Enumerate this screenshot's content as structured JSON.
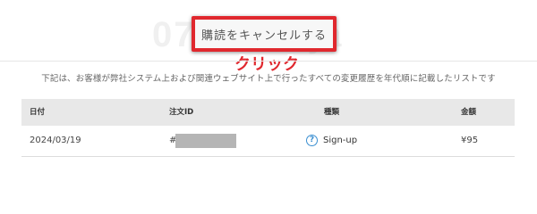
{
  "watermark": "0723.ninja",
  "cancel_button": {
    "label": "購読をキャンセルする"
  },
  "annotation": {
    "click_label": "クリック"
  },
  "intro_text": "下記は、お客様が弊社システム上および関連ウェブサイト上で行ったすべての変更履歴を年代順に記載したリストです",
  "table": {
    "columns": {
      "date": "日付",
      "order_id": "注文ID",
      "type": "種類",
      "amount": "金額"
    },
    "rows": [
      {
        "date": "2024/03/19",
        "order_prefix": "#",
        "type": "Sign-up",
        "amount": "¥95",
        "type_icon": "help-circle-icon"
      }
    ]
  },
  "colors": {
    "highlight": "#e0282e",
    "header_bg": "#e8e8e8",
    "icon": "#3b8fd1"
  }
}
